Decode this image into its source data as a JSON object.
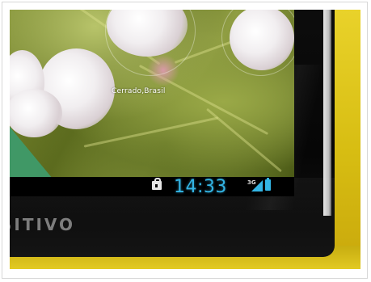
{
  "screen": {
    "photo_caption": "Cerrado,Brasil"
  },
  "status_bar": {
    "time": "14:33",
    "network_type": "3G",
    "icons": [
      "shopping-bag-icon",
      "signal-icon",
      "battery-icon"
    ],
    "accent_color": "#33b5e5"
  },
  "device": {
    "brand_text": "SITIVO",
    "case_color": "#e0c81f",
    "bezel_color": "#0a0a0a"
  }
}
